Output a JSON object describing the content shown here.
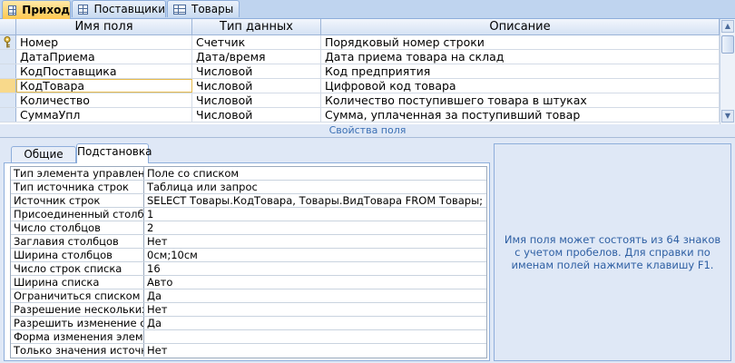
{
  "tabs": [
    {
      "label": "Приход",
      "active": true
    },
    {
      "label": "Поставщики",
      "active": false
    },
    {
      "label": "Товары",
      "active": false
    }
  ],
  "grid": {
    "headers": [
      "Имя поля",
      "Тип данных",
      "Описание"
    ],
    "rows": [
      {
        "name": "Номер",
        "type": "Счетчик",
        "desc": "Порядковый номер строки"
      },
      {
        "name": "ДатаПриема",
        "type": "Дата/время",
        "desc": "Дата приема товара на склад"
      },
      {
        "name": "КодПоставщика",
        "type": "Числовой",
        "desc": "Код предприятия"
      },
      {
        "name": "КодТовара",
        "type": "Числовой",
        "desc": "Цифровой код товара"
      },
      {
        "name": "Количество",
        "type": "Числовой",
        "desc": "Количество поступившего товара в штуках"
      },
      {
        "name": "СуммаУпл",
        "type": "Числовой",
        "desc": "Сумма, уплаченная за поступивший товар"
      }
    ]
  },
  "field_properties_label": "Свойства поля",
  "prop_tabs": [
    "Общие",
    "Подстановка"
  ],
  "properties": [
    {
      "name": "Тип элемента управления",
      "value": "Поле со списком"
    },
    {
      "name": "Тип источника строк",
      "value": "Таблица или запрос"
    },
    {
      "name": "Источник строк",
      "value": "SELECT Товары.КодТовара, Товары.ВидТовара FROM Товары;"
    },
    {
      "name": "Присоединенный столбец",
      "value": "1"
    },
    {
      "name": "Число столбцов",
      "value": "2"
    },
    {
      "name": "Заглавия столбцов",
      "value": "Нет"
    },
    {
      "name": "Ширина столбцов",
      "value": "0см;10см"
    },
    {
      "name": "Число строк списка",
      "value": "16"
    },
    {
      "name": "Ширина списка",
      "value": "Авто"
    },
    {
      "name": "Ограничиться списком",
      "value": "Да"
    },
    {
      "name": "Разрешение нескольких значений",
      "value": "Нет"
    },
    {
      "name": "Разрешить изменение списка значений",
      "value": "Да"
    },
    {
      "name": "Форма изменения элементов списка",
      "value": ""
    },
    {
      "name": "Только значения источника строк",
      "value": "Нет"
    }
  ],
  "help_text": "Имя поля может состоять из 64 знаков с учетом пробелов.  Для справки по именам полей нажмите клавишу F1."
}
